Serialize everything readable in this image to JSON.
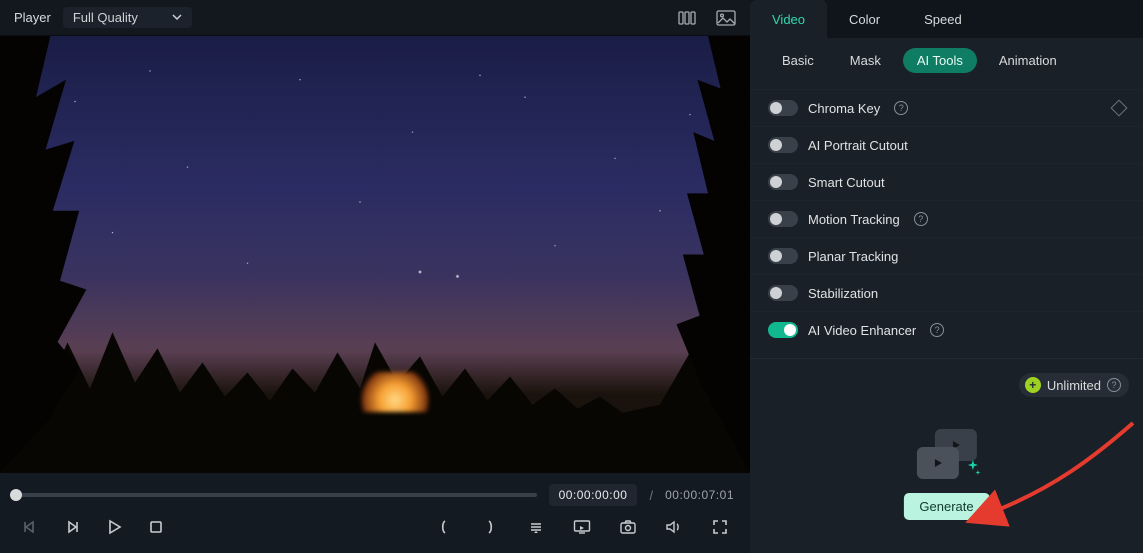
{
  "player": {
    "title": "Player",
    "quality_label": "Full Quality",
    "current_time": "00:00:00:00",
    "duration": "00:00:07:01",
    "time_separator": "/"
  },
  "top_tabs": [
    {
      "label": "Video",
      "active": true
    },
    {
      "label": "Color",
      "active": false
    },
    {
      "label": "Speed",
      "active": false
    }
  ],
  "sub_tabs": [
    {
      "label": "Basic",
      "active": false
    },
    {
      "label": "Mask",
      "active": false
    },
    {
      "label": "AI Tools",
      "active": true
    },
    {
      "label": "Animation",
      "active": false
    }
  ],
  "tools": [
    {
      "label": "Chroma Key",
      "on": false,
      "help": true,
      "keyframe": true
    },
    {
      "label": "AI Portrait Cutout",
      "on": false,
      "help": false,
      "keyframe": false
    },
    {
      "label": "Smart Cutout",
      "on": false,
      "help": false,
      "keyframe": false
    },
    {
      "label": "Motion Tracking",
      "on": false,
      "help": true,
      "keyframe": false
    },
    {
      "label": "Planar Tracking",
      "on": false,
      "help": false,
      "keyframe": false
    },
    {
      "label": "Stabilization",
      "on": false,
      "help": false,
      "keyframe": false
    },
    {
      "label": "AI Video Enhancer",
      "on": true,
      "help": true,
      "keyframe": false
    }
  ],
  "unlimited_label": "Unlimited",
  "generate_label": "Generate",
  "colors": {
    "accent": "#2fd9b0",
    "arrow": "#e43b2e"
  }
}
